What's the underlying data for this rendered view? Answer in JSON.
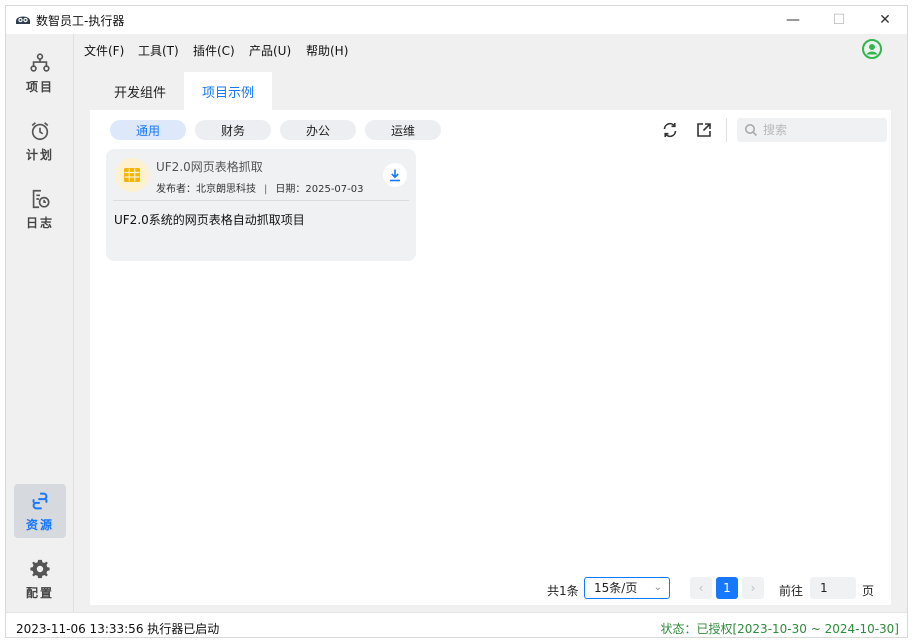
{
  "window": {
    "title": "数智员工-执行器",
    "minimize_glyph": "—",
    "maximize_glyph": "☐",
    "close_glyph": "✕"
  },
  "sidebar": {
    "items": [
      {
        "label": "项目",
        "icon": "project-tree-icon"
      },
      {
        "label": "计划",
        "icon": "alarm-clock-icon"
      },
      {
        "label": "日志",
        "icon": "log-clock-icon"
      },
      {
        "label": "资源",
        "icon": "resource-icon",
        "active": true
      },
      {
        "label": "配置",
        "icon": "gear-icon"
      }
    ]
  },
  "menubar": {
    "items": [
      "文件(F)",
      "工具(T)",
      "插件(C)",
      "产品(U)",
      "帮助(H)"
    ],
    "user_icon": "user-circle-icon"
  },
  "tabs": [
    {
      "label": "开发组件",
      "active": false
    },
    {
      "label": "项目示例",
      "active": true
    }
  ],
  "categories": [
    {
      "label": "通用",
      "active": true
    },
    {
      "label": "财务",
      "active": false
    },
    {
      "label": "办公",
      "active": false
    },
    {
      "label": "运维",
      "active": false
    }
  ],
  "toolbar": {
    "refresh_icon": "refresh-icon",
    "export_icon": "external-link-icon",
    "search_placeholder": "搜索",
    "search_value": ""
  },
  "cards": [
    {
      "title": "UF2.0网页表格抓取",
      "publisher": "发布者：北京朗思科技",
      "separator": "|",
      "date": "日期：2025-07-03",
      "description": "UF2.0系统的网页表格自动抓取项目",
      "icon": "table-grid-icon",
      "download_icon": "download-icon"
    }
  ],
  "pagination": {
    "total": "共1条",
    "page_size": "15条/页",
    "prev": "‹",
    "current_page": "1",
    "next": "›",
    "goto_label": "前往",
    "goto_value": "1",
    "page_suffix": "页"
  },
  "status": {
    "left": "2023-11-06 13:33:56 执行器已启动",
    "right": "状态：已授权[2023-10-30 ~ 2024-10-30]"
  },
  "colors": {
    "accent": "#1677ff",
    "status_green": "#2e8b3a",
    "user_icon_green": "#2fb84b",
    "card_icon_bg": "#fdf1d0",
    "card_icon_fg": "#f4b400"
  }
}
